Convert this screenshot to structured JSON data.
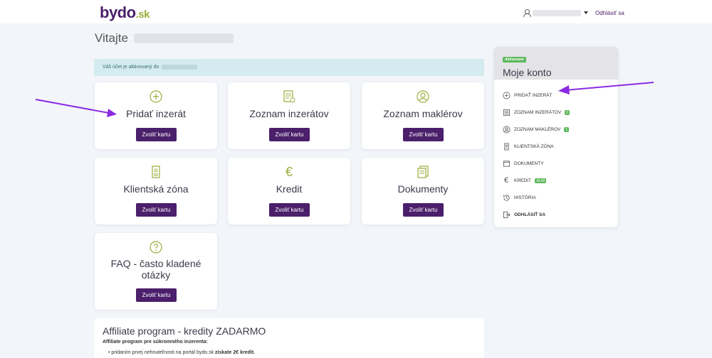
{
  "header": {
    "logo_main": "bydo",
    "logo_tld": ".sk",
    "logout_label": "Odhlásiť sa"
  },
  "welcome": {
    "label": "Vitajte"
  },
  "alert": {
    "text": "Váš účet je aktivovaný do"
  },
  "cards": [
    {
      "title": "Pridať inzerát",
      "button": "Zvoliť kartu",
      "icon": "plus-circle-icon"
    },
    {
      "title": "Zoznam inzerátov",
      "button": "Zvoliť kartu",
      "icon": "list-document-icon"
    },
    {
      "title": "Zoznam maklérov",
      "button": "Zvoliť kartu",
      "icon": "user-circle-icon"
    },
    {
      "title": "Klientská zóna",
      "button": "Zvoliť kartu",
      "icon": "id-badge-icon"
    },
    {
      "title": "Kredit",
      "button": "Zvoliť kartu",
      "icon": "euro-icon"
    },
    {
      "title": "Dokumenty",
      "button": "Zvoliť kartu",
      "icon": "documents-icon"
    },
    {
      "title": "FAQ - často kladené otázky",
      "button": "Zvoliť kartu",
      "icon": "question-circle-icon"
    }
  ],
  "affiliate": {
    "title": "Affiliate program - kredity ZADARMO",
    "subtitle": "Affiliate program pre súkromného inzerenta:",
    "bullet_prefix": "pridaním prvej nehnuteľnosti na portál bydo.sk",
    "bullet_bold": "získate 2€ kredit."
  },
  "account": {
    "badge": "Aktivované",
    "title": "Moje konto",
    "menu": [
      {
        "label": "Pridať inzerát",
        "icon": "plus-circle-icon"
      },
      {
        "label": "Zoznam inzerátov",
        "icon": "list-document-icon",
        "badge": "0"
      },
      {
        "label": "Zoznam maklérov",
        "icon": "user-circle-icon",
        "badge": "1"
      },
      {
        "label": "Klientská zóna",
        "icon": "id-badge-icon"
      },
      {
        "label": "Dokumenty",
        "icon": "documents-icon"
      },
      {
        "label": "Kredit",
        "icon": "euro-icon",
        "badge": "18,00"
      },
      {
        "label": "História",
        "icon": "history-icon"
      },
      {
        "label": "Odhlásiť sa",
        "icon": "logout-icon"
      }
    ]
  },
  "colors": {
    "brand": "#4b1f6b",
    "accent": "#9aae3c",
    "badge_green": "#5cb85c",
    "annotation_arrow": "#8a2be2"
  }
}
